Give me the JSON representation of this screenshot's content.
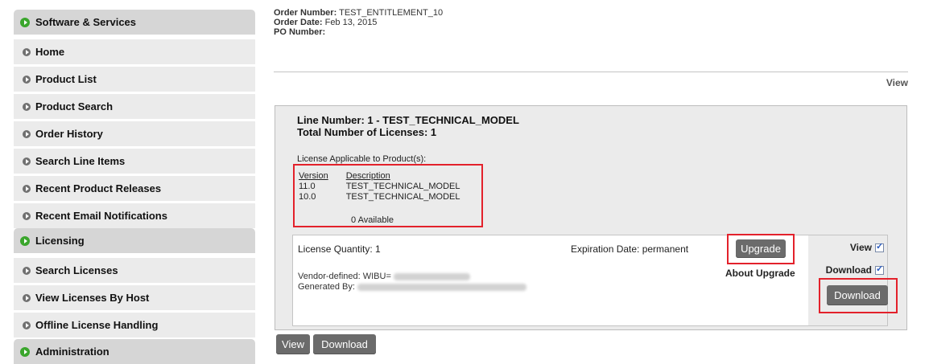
{
  "sidebar": {
    "items": [
      {
        "label": "Software & Services",
        "type": "section"
      },
      {
        "label": "Home",
        "type": "item"
      },
      {
        "label": "Product List",
        "type": "item"
      },
      {
        "label": "Product Search",
        "type": "item"
      },
      {
        "label": "Order History",
        "type": "item"
      },
      {
        "label": "Search Line Items",
        "type": "item"
      },
      {
        "label": "Recent Product Releases",
        "type": "item"
      },
      {
        "label": "Recent Email Notifications",
        "type": "item"
      },
      {
        "label": "Licensing",
        "type": "section"
      },
      {
        "label": "Search Licenses",
        "type": "item"
      },
      {
        "label": "View Licenses By Host",
        "type": "item"
      },
      {
        "label": "Offline License Handling",
        "type": "item"
      },
      {
        "label": "Administration",
        "type": "section"
      }
    ]
  },
  "order": {
    "number_label": "Order Number:",
    "number": "TEST_ENTITLEMENT_10",
    "date_label": "Order Date:",
    "date": "Feb 13, 2015",
    "po_label": "PO Number:",
    "po": ""
  },
  "view_link": "View",
  "line": {
    "line_number": "Line Number: 1 - TEST_TECHNICAL_MODEL",
    "total_licenses": "Total Number of Licenses: 1",
    "applicable_label": "License Applicable to Product(s):",
    "columns": [
      "Version",
      "Description"
    ],
    "products": [
      {
        "version": "11.0",
        "description": "TEST_TECHNICAL_MODEL"
      },
      {
        "version": "10.0",
        "description": "TEST_TECHNICAL_MODEL"
      }
    ],
    "available": "0 Available"
  },
  "license": {
    "quantity": "License Quantity: 1",
    "expiration": "Expiration Date: permanent",
    "vendor_label": "Vendor-defined: WIBU=",
    "generated_label": "Generated By:",
    "upgrade_button": "Upgrade",
    "about_upgrade": "About Upgrade",
    "view_label": "View",
    "view_checked": true,
    "download_label": "Download",
    "download_checked": true,
    "download_button": "Download"
  },
  "bottom": {
    "view_button": "View",
    "download_button": "Download"
  },
  "colors": {
    "highlight": "#e3212b",
    "section_bullet": "#3aa62c",
    "item_bullet": "#707070",
    "button": "#6b6b6b"
  }
}
